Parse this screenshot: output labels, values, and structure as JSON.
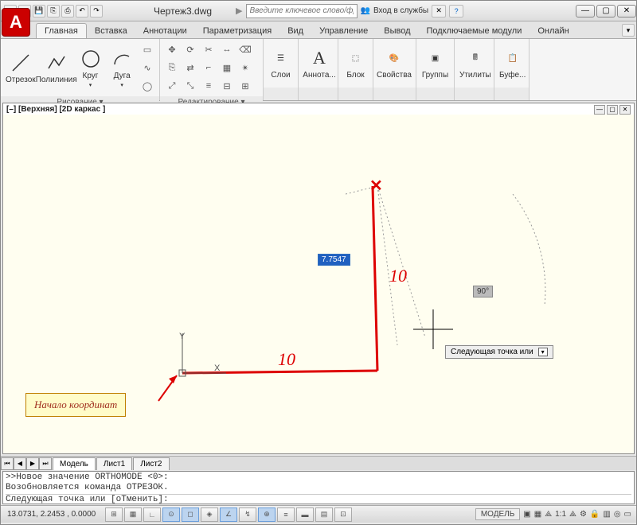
{
  "title": "Чертеж3.dwg",
  "search": {
    "placeholder": "Введите ключевое слово/фразу",
    "login": "Вход в службы"
  },
  "tabs": [
    "Главная",
    "Вставка",
    "Аннотации",
    "Параметризация",
    "Вид",
    "Управление",
    "Вывод",
    "Подключаемые модули",
    "Онлайн"
  ],
  "active_tab": 0,
  "ribbon": {
    "draw": {
      "title": "Рисование ▾",
      "items": [
        "Отрезок",
        "Полилиния",
        "Круг",
        "Дуга"
      ]
    },
    "modify": {
      "title": "Редактирование ▾"
    },
    "layers": {
      "title": "Слои"
    },
    "annot": {
      "title": "Аннота..."
    },
    "block": {
      "title": "Блок"
    },
    "props": {
      "title": "Свойства"
    },
    "groups": {
      "title": "Группы"
    },
    "util": {
      "title": "Утилиты"
    },
    "clip": {
      "title": "Буфе..."
    }
  },
  "viewport": {
    "label": "[–] [Верхняя] [2D каркас ]"
  },
  "drawing": {
    "annotation": "Начало  координат",
    "len_value": "7.7547",
    "angle_value": "90°",
    "tooltip": "Следующая точка или",
    "red_label_h": "10",
    "red_label_v": "10",
    "axis_x": "X",
    "axis_y": "Y"
  },
  "model_tabs": [
    "Модель",
    "Лист1",
    "Лист2"
  ],
  "cmd": {
    "hist1": ">>Новое значение ORTHOMODE <0>:",
    "hist2": "Возобновляется команда ОТРЕЗОК.",
    "prompt": "Следующая точка или [оТменить]:"
  },
  "status": {
    "coords": "13.0731, 2.2453 , 0.0000",
    "model": "МОДЕЛЬ",
    "scale": "1:1"
  }
}
